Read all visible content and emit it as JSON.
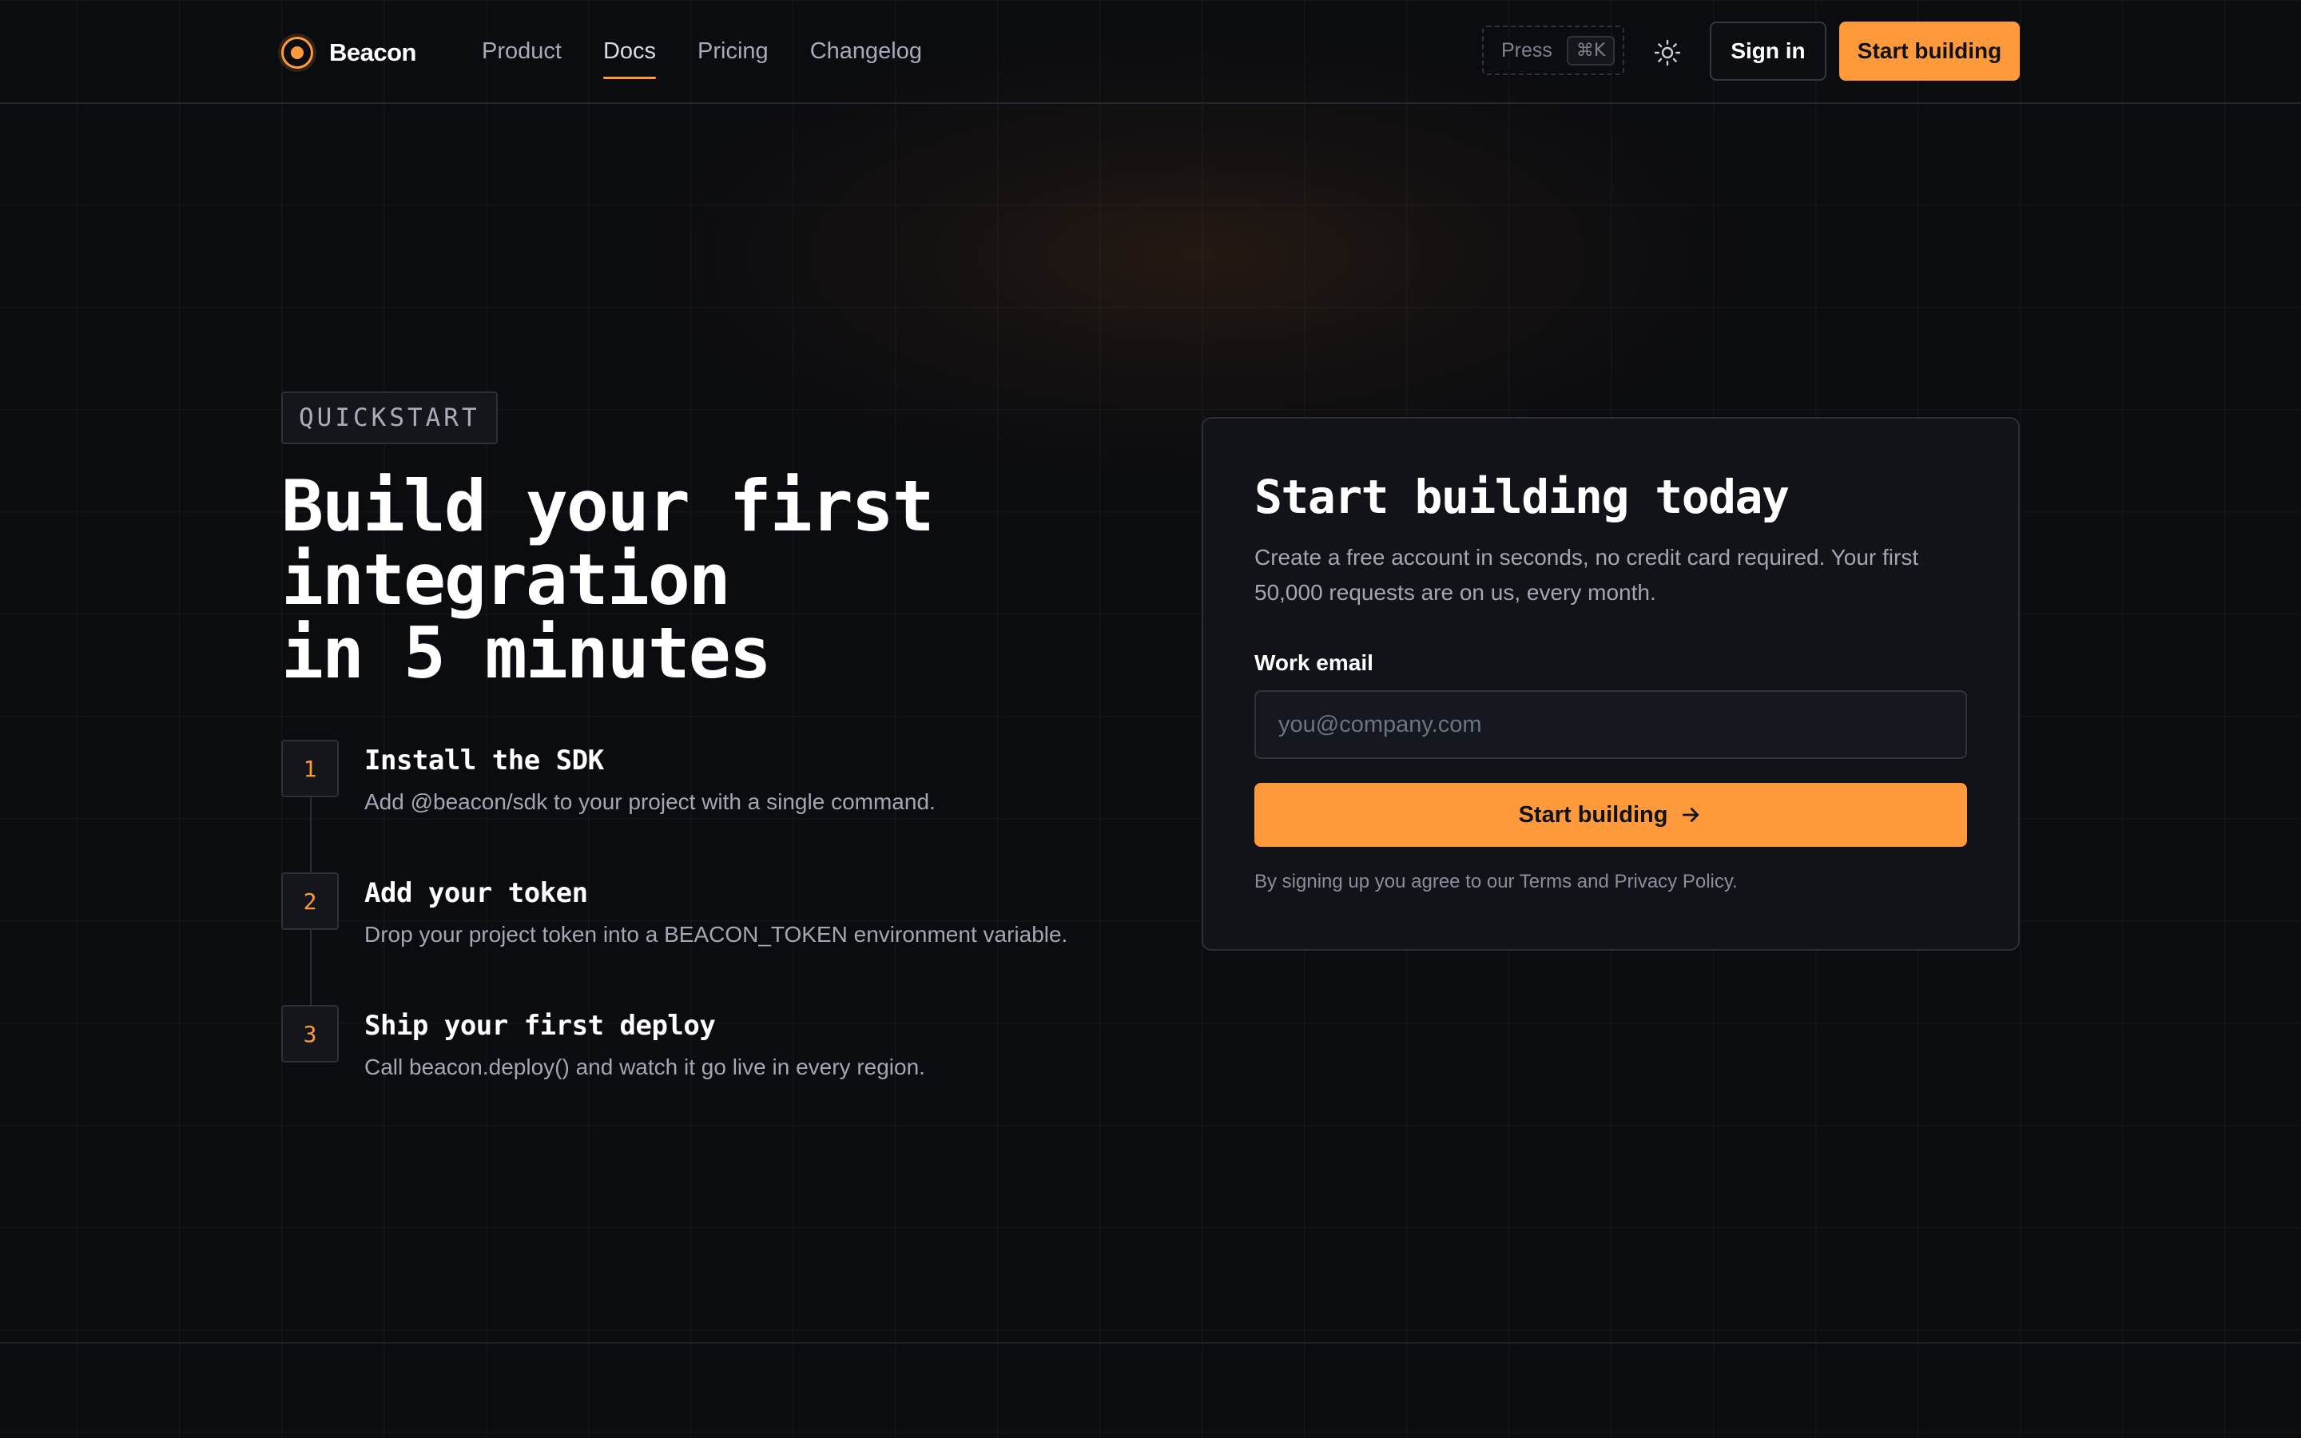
{
  "header": {
    "logo_name": "Beacon",
    "nav": [
      {
        "label": "Product",
        "active": false
      },
      {
        "label": "Docs",
        "active": true
      },
      {
        "label": "Pricing",
        "active": false
      },
      {
        "label": "Changelog",
        "active": false
      }
    ],
    "search_hint": "Press",
    "search_shortcut": "⌘K",
    "theme_icon": "sun-icon",
    "sign_in_label": "Sign in",
    "start_label": "Start building"
  },
  "hero": {
    "badge": "QUICKSTART",
    "title_lines": [
      "Build your first",
      "integration",
      "in 5 minutes"
    ],
    "steps": [
      {
        "number": "1",
        "title": "Install the SDK",
        "description": "Add @beacon/sdk to your project with a single command."
      },
      {
        "number": "2",
        "title": "Add your token",
        "description": "Drop your project token into a BEACON_TOKEN environment variable."
      },
      {
        "number": "3",
        "title": "Ship your first deploy",
        "description": "Call beacon.deploy() and watch it go live in every region."
      }
    ]
  },
  "signup_card": {
    "title": "Start building today",
    "description": "Create a free account in seconds, no credit card required. Your first 50,000 requests are on us, every month.",
    "email_label": "Work email",
    "email_placeholder": "you@company.com",
    "email_value": "",
    "submit_label": "Start building",
    "submit_icon": "arrow-right-icon",
    "footer": "By signing up you agree to our Terms and Privacy Policy."
  },
  "colors": {
    "accent": "#ff9a3c",
    "background": "#0b0c10",
    "card": "#111318"
  }
}
